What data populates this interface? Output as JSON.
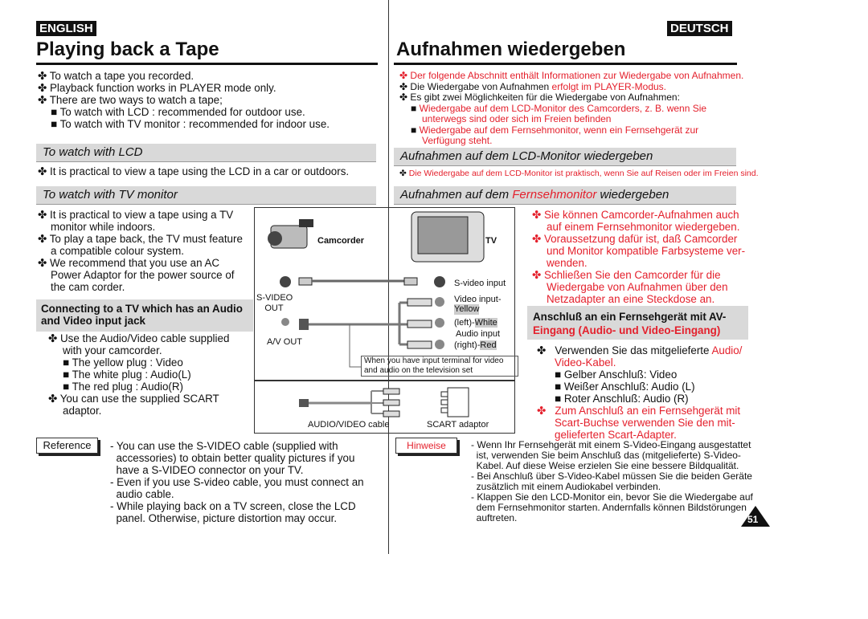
{
  "en": {
    "badge": "ENGLISH",
    "title": "Playing back a Tape",
    "intro": [
      "To watch a tape you recorded.",
      "Playback function works in PLAYER mode only.",
      "There are two ways to watch a tape;"
    ],
    "intro_sub": [
      "To watch with LCD : recommended for outdoor use.",
      "To watch with TV monitor : recommended for indoor use."
    ],
    "lcd_title": "To watch with LCD",
    "lcd_text": "It is practical to view a tape using the LCD in a car or outdoors.",
    "tv_title": "To watch with TV monitor",
    "tv_lines": [
      "It is practical to view a tape using a TV",
      "monitor while indoors.",
      "To play a tape back, the TV must feature",
      "a compatible colour system.",
      "We recommend that you use an AC",
      "Power Adaptor for the power source of",
      "the cam corder."
    ],
    "connect_title": [
      "Connecting to a TV which has an Audio",
      "and Video input jack"
    ],
    "connect_lines": [
      "Use the Audio/Video cable supplied",
      "with your camcorder."
    ],
    "plugs": [
      "The yellow plug : Video",
      "The white plug : Audio(L)",
      "The red plug : Audio(R)"
    ],
    "scart": [
      "You can use the supplied SCART",
      "adaptor."
    ],
    "reference_label": "Reference",
    "reference": [
      "- You can use the S-VIDEO cable (supplied with",
      "  accessories) to obtain better quality pictures if you",
      "  have a S-VIDEO connector on your TV.",
      "- Even if you use S-video cable, you must connect an",
      "  audio cable.",
      "- While playing back on a TV screen, close the LCD",
      "  panel. Otherwise, picture distortion may occur."
    ]
  },
  "diagram": {
    "camcorder": "Camcorder",
    "tv": "TV",
    "svideo_input": "S-video input",
    "svideo_out": [
      "S-VIDEO",
      "OUT"
    ],
    "av_out": "A/V OUT",
    "video_input": "Video input-",
    "yellow": "Yellow",
    "left": "(left)-",
    "white": "White",
    "audio_input": "Audio input",
    "right": "(right)-",
    "red": "Red",
    "note": [
      "When you have input terminal for video",
      "and audio on the television set"
    ],
    "av_cable": "AUDIO/VIDEO cable",
    "scart_adaptor": "SCART adaptor"
  },
  "de": {
    "badge": "DEUTSCH",
    "title": "Aufnahmen wiedergeben",
    "intro1": "Der folgende Abschnitt enthält Informationen zur Wiedergabe von Aufnahmen.",
    "intro2a": "Die Wiedergabe von Aufnahmen ",
    "intro2b": "erfolgt im PLAYER-Modus.",
    "intro3": "Es gibt zwei Möglichkeiten für die Wiedergabe von Aufnahmen:",
    "sub1": [
      "Wiedergabe auf dem LCD-Monitor des Camcorders, z. B. wenn Sie",
      "unterwegs sind oder sich im Freien befinden"
    ],
    "sub2": [
      "Wiedergabe auf dem Fernsehmonitor, wenn ein Fernsehgerät zur",
      "Verfügung steht."
    ],
    "lcd_title": "Aufnahmen auf dem LCD-Monitor wiedergeben",
    "lcd_text_a": "Die Wiedergabe auf dem LCD-Monitor ist praktisch, wenn Sie auf Reisen oder im Freien sind.",
    "tv_title_a": "Aufnahmen auf dem ",
    "tv_title_b": "Fernsehmonitor",
    "tv_title_c": " wiedergeben",
    "tv_lines": [
      "Sie können Camcorder-Aufnahmen auch",
      "auf einem Fernsehmonitor wiedergeben.",
      "Voraussetzung dafür ist, daß Camcorder",
      "und Monitor kompatible Farbsysteme ver-",
      "wenden.",
      "Schließen Sie den Camcorder für die",
      "Wiedergabe von Aufnahmen über den",
      "Netzadapter an eine Steckdose an."
    ],
    "connect_title_a": "Anschluß an ein Fernsehgerät mit AV-",
    "connect_title_b": "Eingang (Audio- und Video-Eingang)",
    "connect_a": "Verwenden Sie das mitgelieferte ",
    "connect_b": "Audio/",
    "connect_c": "Video-Kabel.",
    "plugs": [
      "Gelber Anschluß: Video",
      "Weißer Anschluß: Audio (L)",
      "Roter Anschluß: Audio (R)"
    ],
    "scart": [
      "Zum Anschluß an ein Fernsehgerät mit",
      "Scart-Buchse verwenden Sie den mit-",
      "gelieferten Scart-Adapter."
    ],
    "notes_label": "Hinweise",
    "notes": [
      "- Wenn Ihr Fernsehgerät mit einem S-Video-Eingang ausgestattet",
      "  ist, verwenden Sie beim Anschluß das (mitgelieferte) S-Video-",
      "  Kabel. Auf diese Weise erzielen Sie eine bessere Bildqualität.",
      "- Bei Anschluß über S-Video-Kabel müssen Sie die beiden Geräte",
      "  zusätzlich mit einem Audiokabel verbinden.",
      "- Klappen Sie den LCD-Monitor ein, bevor Sie die Wiedergabe auf",
      "  dem Fernsehmonitor starten. Andernfalls können Bildstörungen",
      "  auftreten."
    ]
  },
  "page_number": "51",
  "bullet": "✤",
  "square": "■",
  "colors": {
    "accent_red": "#e4202c",
    "bar_gray": "#d9d9d9"
  }
}
